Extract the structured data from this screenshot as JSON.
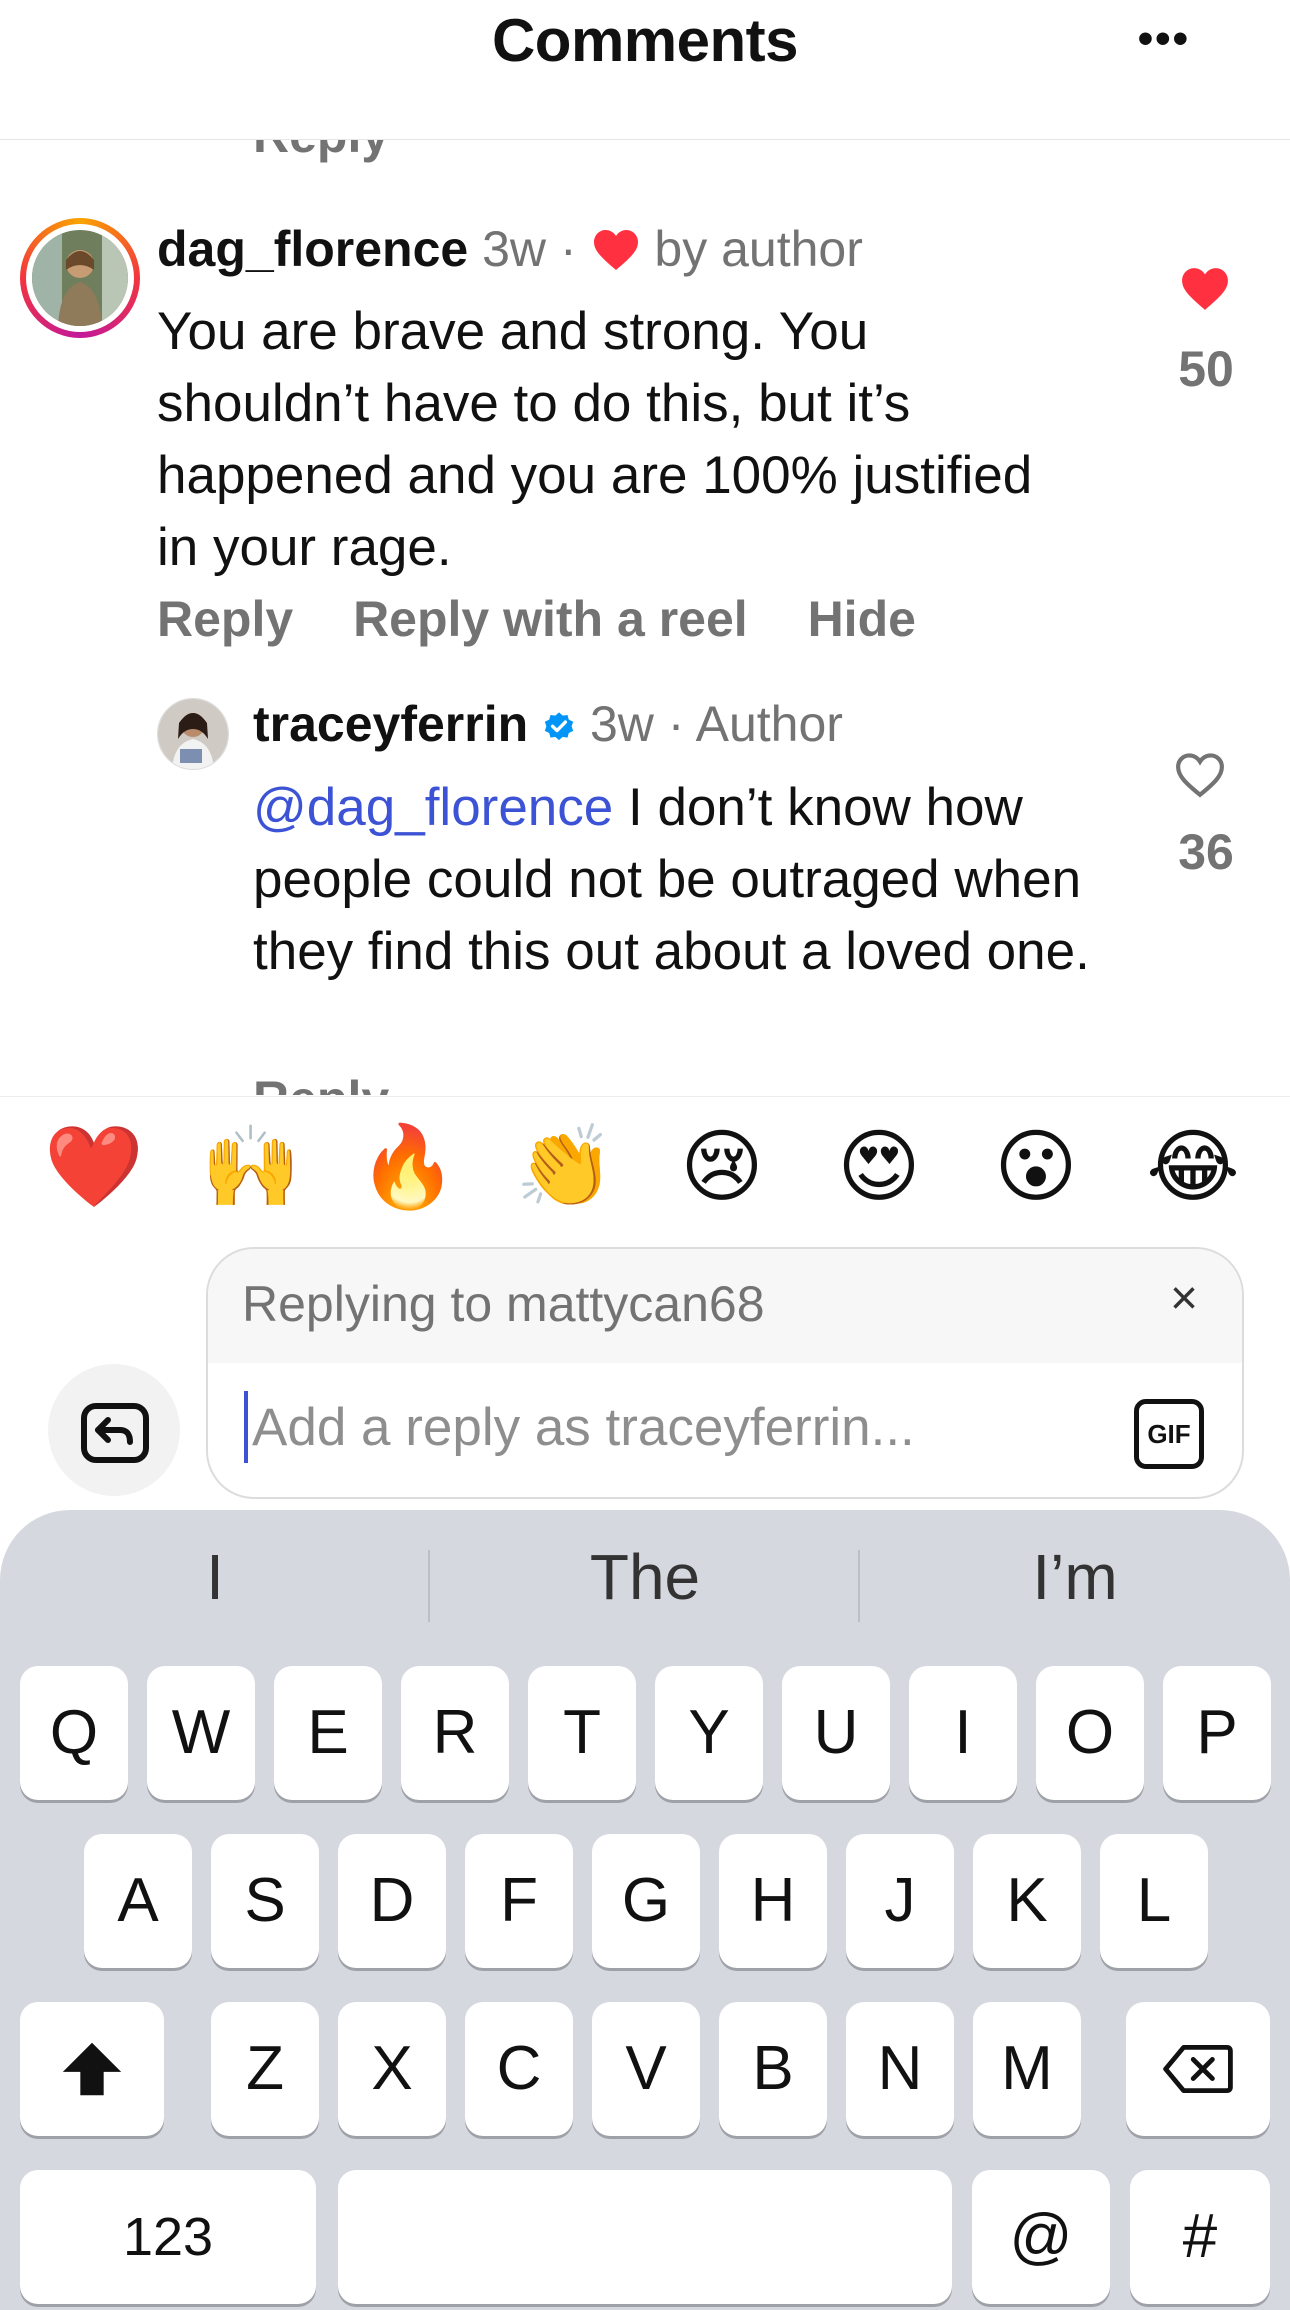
{
  "header": {
    "title": "Comments",
    "more_label": "•••"
  },
  "previous": {
    "reply_label": "Reply"
  },
  "comment": {
    "username": "dag_florence",
    "time": "3w",
    "separator": "·",
    "by_author_label": "by author",
    "text": "You are brave and strong. You shouldn’t have to do this, but it’s happened and you are 100% justified in your rage.",
    "actions": {
      "reply": "Reply",
      "reply_reel": "Reply with a reel",
      "hide": "Hide"
    },
    "likes": "50",
    "liked": true
  },
  "reply": {
    "username": "traceyferrin",
    "verified": true,
    "time": "3w",
    "separator": "·",
    "author_label": "Author",
    "mention": "@dag_florence",
    "text": " I don’t know how people could not be outraged when they find this out about a loved one.",
    "likes": "36",
    "liked": false,
    "cut_reply_label": "Reply"
  },
  "emoji_bar": [
    "❤️",
    "🙌",
    "🔥",
    "👏",
    "😢",
    "😍",
    "😮",
    "😂"
  ],
  "composer": {
    "replying_to": "Replying to mattycan68",
    "close_label": "×",
    "placeholder": "Add a reply as traceyferrin...",
    "gif_label": "GIF"
  },
  "keyboard": {
    "suggestions": [
      "I",
      "The",
      "I’m"
    ],
    "row1": [
      "Q",
      "W",
      "E",
      "R",
      "T",
      "Y",
      "U",
      "I",
      "O",
      "P"
    ],
    "row2": [
      "A",
      "S",
      "D",
      "F",
      "G",
      "H",
      "J",
      "K",
      "L"
    ],
    "row3": [
      "Z",
      "X",
      "C",
      "V",
      "B",
      "N",
      "M"
    ],
    "numbers_label": "123",
    "at_label": "@",
    "hash_label": "#"
  },
  "colors": {
    "like_red": "#ff3040",
    "mention_blue": "#3d53d6",
    "verified_blue": "#0095f6"
  }
}
